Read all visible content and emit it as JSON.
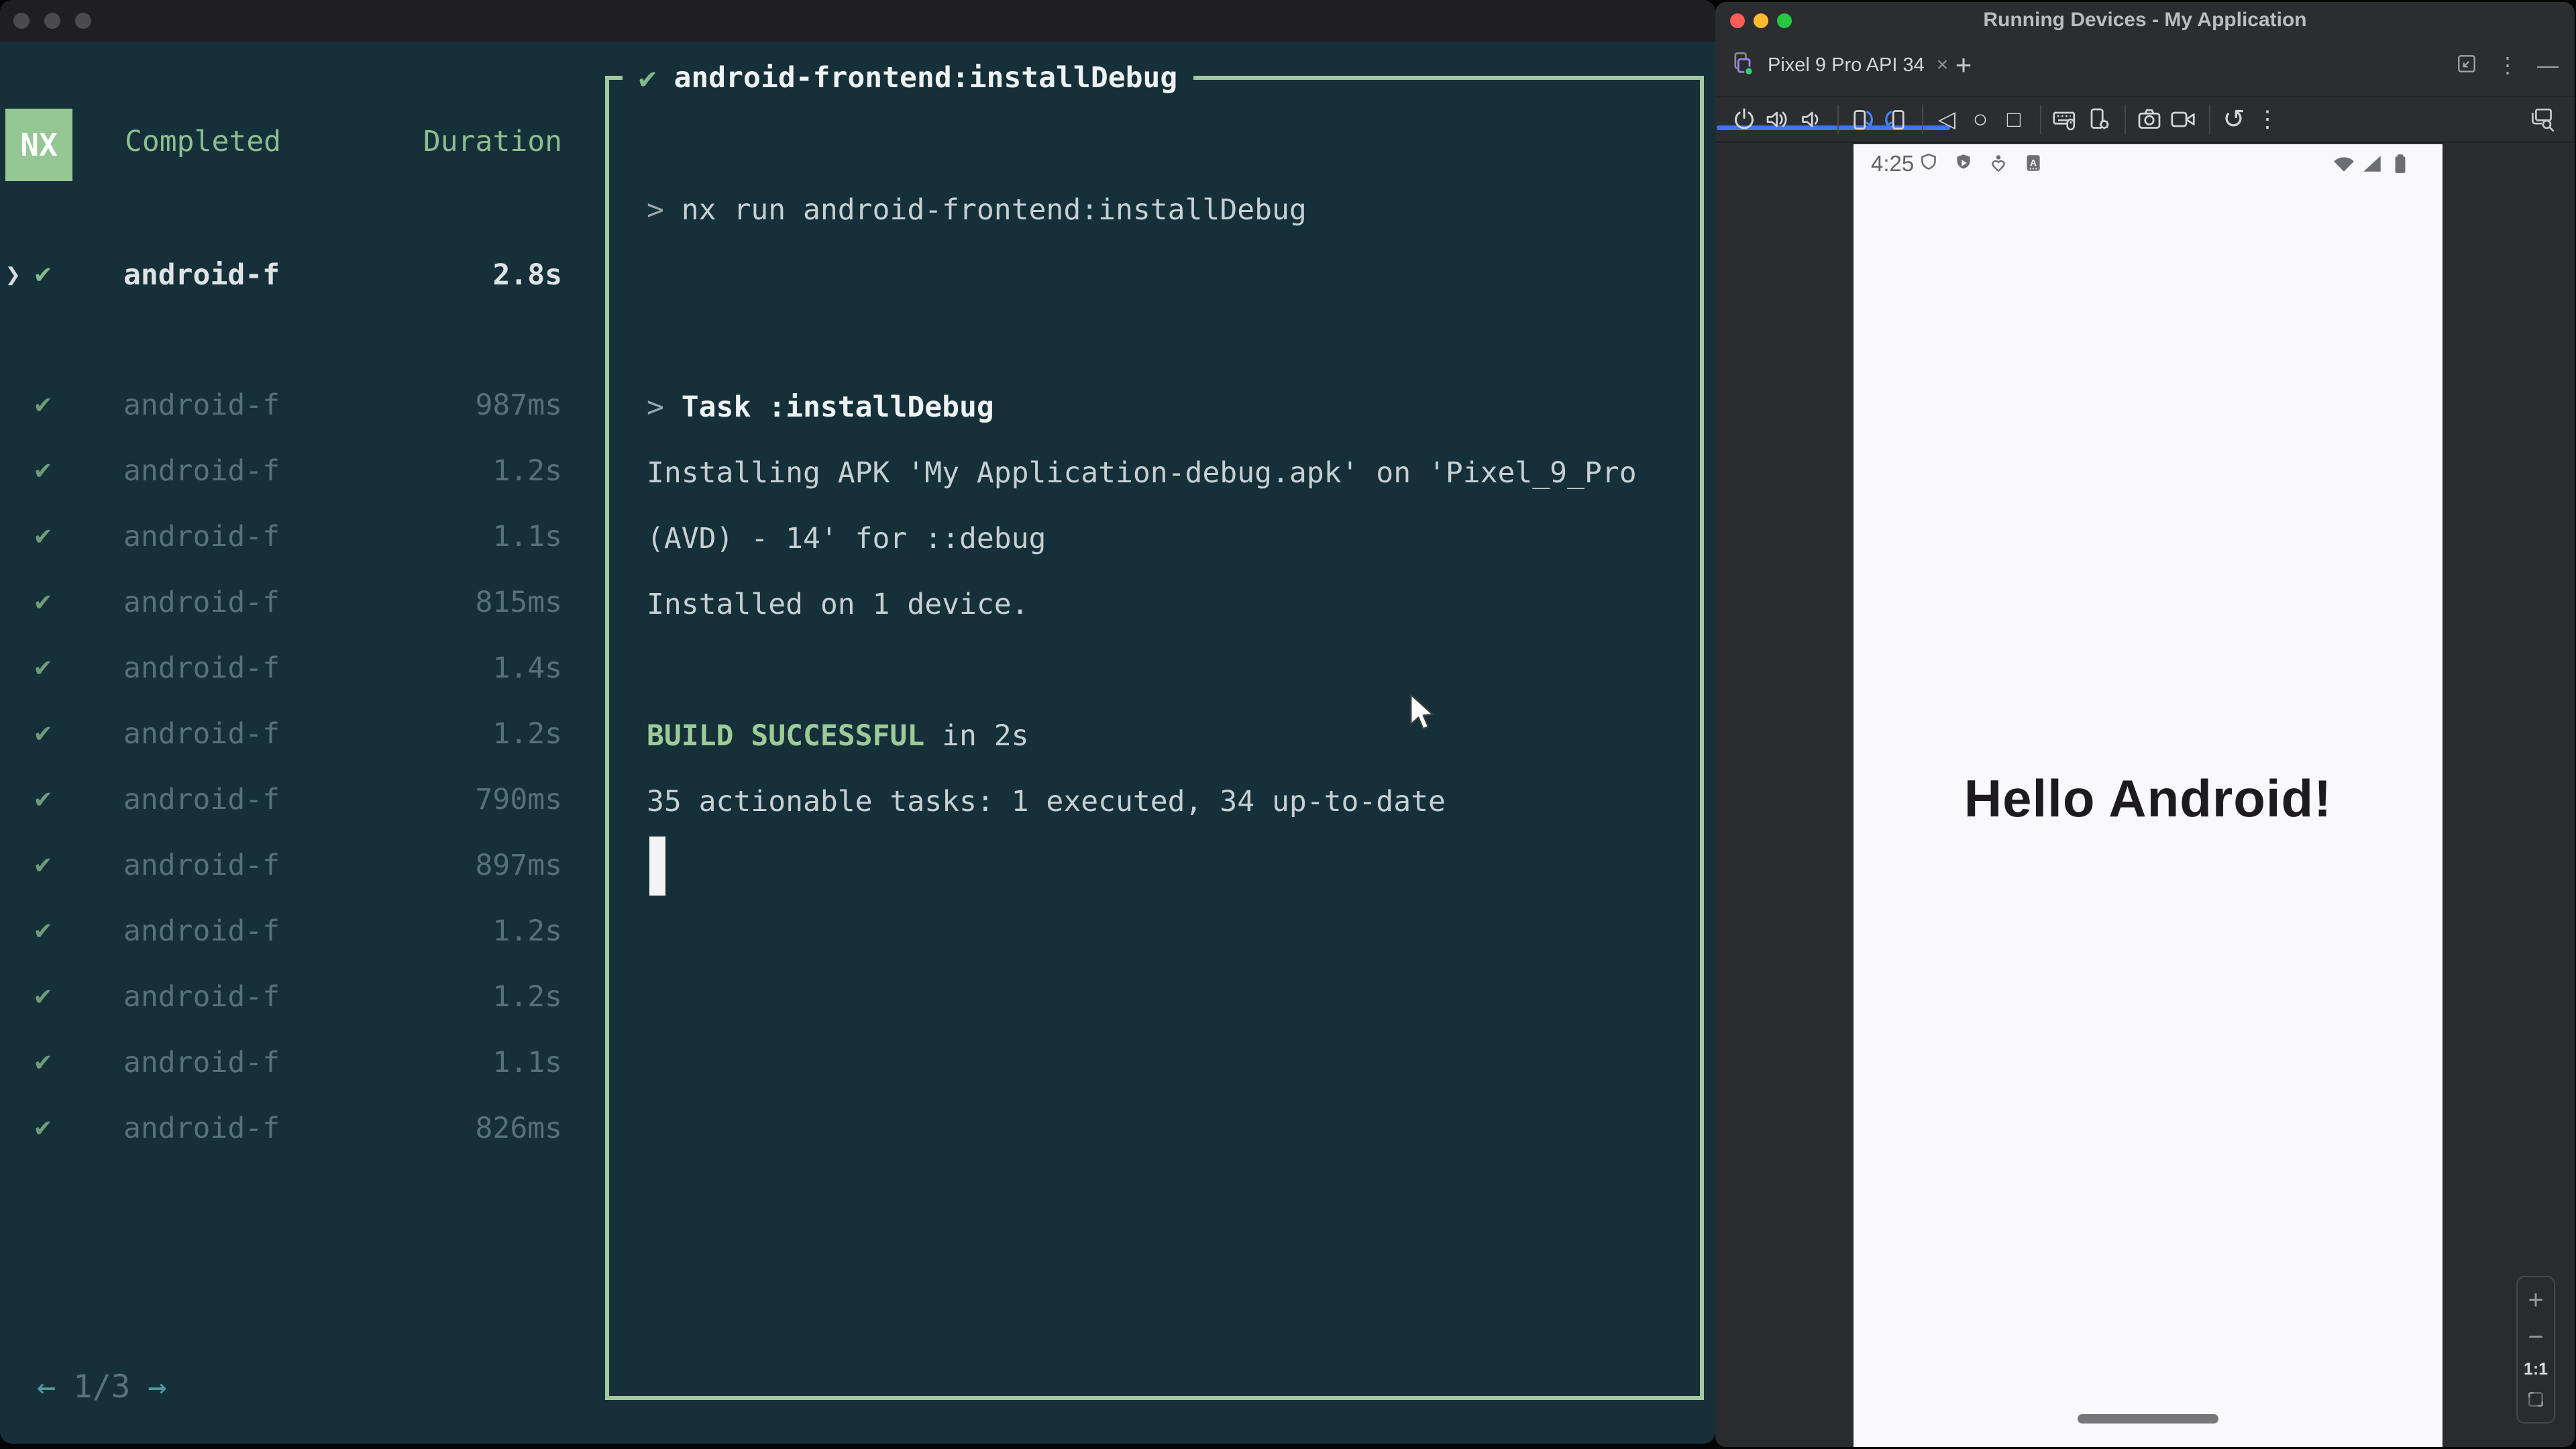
{
  "glyphs": {
    "check": "✔",
    "chevron": "❯",
    "prompt": ">",
    "close": "×",
    "plus": "+",
    "minus": "—",
    "dots": "⋮",
    "back": "◁",
    "home": "○",
    "recents": "□",
    "restart": "↺",
    "arrow_left": "←",
    "arrow_right": "→",
    "zoom_in": "+",
    "zoom_out": "−"
  },
  "terminal": {
    "header": {
      "logo": "NX",
      "completed_label": "Completed",
      "duration_label": "Duration"
    },
    "selected_task": {
      "name": "android-f",
      "duration": "2.8s"
    },
    "tasks": [
      {
        "name": "android-f",
        "duration": "987ms"
      },
      {
        "name": "android-f",
        "duration": "1.2s"
      },
      {
        "name": "android-f",
        "duration": "1.1s"
      },
      {
        "name": "android-f",
        "duration": "815ms"
      },
      {
        "name": "android-f",
        "duration": "1.4s"
      },
      {
        "name": "android-f",
        "duration": "1.2s"
      },
      {
        "name": "android-f",
        "duration": "790ms"
      },
      {
        "name": "android-f",
        "duration": "897ms"
      },
      {
        "name": "android-f",
        "duration": "1.2s"
      },
      {
        "name": "android-f",
        "duration": "1.2s"
      },
      {
        "name": "android-f",
        "duration": "1.1s"
      },
      {
        "name": "android-f",
        "duration": "826ms"
      }
    ],
    "output": {
      "title": "android-frontend:installDebug",
      "command": "nx run android-frontend:installDebug",
      "task_heading": "Task :installDebug",
      "install_line1": "Installing APK 'My Application-debug.apk' on 'Pixel_9_Pro",
      "install_line2": "(AVD) - 14' for ::debug",
      "install_line3": "Installed on 1 device.",
      "build_status": "BUILD SUCCESSFUL",
      "build_time": " in 2s",
      "summary": "35 actionable tasks: 1 executed, 34 up-to-date"
    },
    "pagination": {
      "page": "1/3"
    }
  },
  "studio": {
    "title": "Running Devices - My Application",
    "tab_label": "Pixel 9 Pro API 34",
    "emulator": {
      "time": "4:25",
      "greeting": "Hello Android!"
    },
    "zoom_controls": {
      "actual_size": "1:1"
    }
  },
  "colors": {
    "terminal_bg": "#16303a",
    "panel_border": "#a3c9a0",
    "accent_green": "#9ccb97",
    "dim_text": "#59707a",
    "bright_text": "#dfe3e5",
    "studio_bg": "#2b2d30",
    "tab_underline": "#3e75f2",
    "emulator_bg": "#f9f8fc",
    "traffic_red": "#ff5e57",
    "traffic_yellow": "#ffbb2e",
    "traffic_green": "#27c83f"
  }
}
